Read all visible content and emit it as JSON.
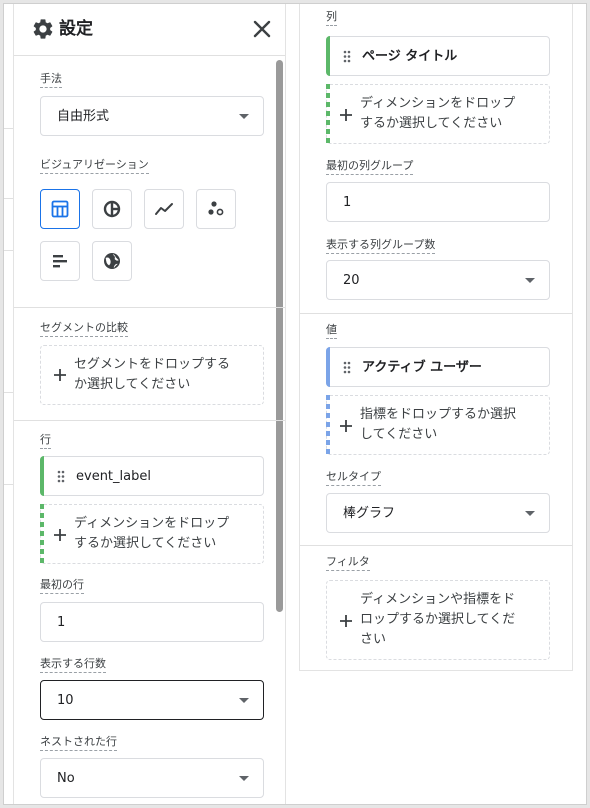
{
  "header": {
    "title": "設定"
  },
  "left": {
    "method_label": "手法",
    "method_value": "自由形式",
    "viz_label": "ビジュアリゼーション",
    "viz_icons": [
      "table-icon",
      "donut-chart-icon",
      "line-chart-icon",
      "scatter-icon",
      "bar-chart-icon",
      "globe-icon"
    ],
    "segment_label": "セグメントの比較",
    "segment_drop": [
      "セグメントをドロップする",
      "か選択してください"
    ],
    "rows_label": "行",
    "rows_chip": "event_label",
    "rows_drop": [
      "ディメンションをドロップ",
      "するか選択してください"
    ],
    "first_row_label": "最初の行",
    "first_row_value": "1",
    "show_rows_label": "表示する行数",
    "show_rows_value": "10",
    "nested_label": "ネストされた行",
    "nested_value": "No"
  },
  "right": {
    "cols_label": "列",
    "cols_chip": "ページ タイトル",
    "cols_drop": [
      "ディメンションをドロップ",
      "するか選択してください"
    ],
    "first_col_group_label": "最初の列グループ",
    "first_col_group_value": "1",
    "show_col_groups_label": "表示する列グループ数",
    "show_col_groups_value": "20",
    "values_label": "値",
    "values_chip": "アクティブ ユーザー",
    "values_drop": [
      "指標をドロップするか選択",
      "してください"
    ],
    "cell_type_label": "セルタイプ",
    "cell_type_value": "棒グラフ",
    "filter_label": "フィルタ",
    "filter_drop": [
      "ディメンションや指標をド",
      "ロップするか選択してくだ",
      "さい"
    ]
  },
  "colors": {
    "accent": "#1a73e8",
    "dim_bar": "#5cb869",
    "metric_bar": "#7ba4e8"
  }
}
